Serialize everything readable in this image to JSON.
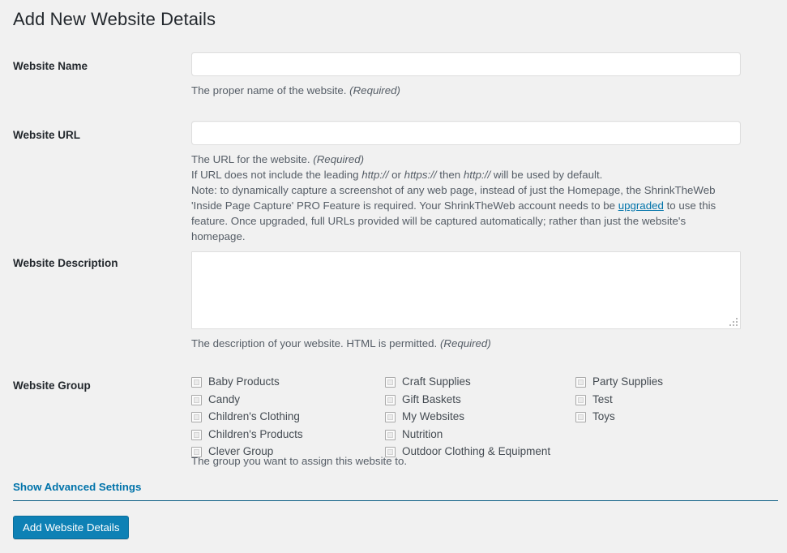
{
  "page": {
    "title": "Add New Website Details",
    "background_color": "#f1f1f1",
    "accent_color": "#0073aa"
  },
  "fields": {
    "website_name": {
      "label": "Website Name",
      "value": "",
      "placeholder": "",
      "help": "The proper name of the website. ",
      "help_required": "(Required)"
    },
    "website_url": {
      "label": "Website URL",
      "value": "",
      "placeholder": "",
      "help_line1": "The URL for the website. ",
      "help_line1_required": "(Required)",
      "help_line2_a": "If URL does not include the leading ",
      "help_line2_proto1": "http://",
      "help_line2_b": " or ",
      "help_line2_proto2": "https://",
      "help_line2_c": " then ",
      "help_line2_proto3": "http://",
      "help_line2_d": " will be used by default.",
      "help_line3_a": "Note: to dynamically capture a screenshot of any web page, instead of just the Homepage, the ShrinkTheWeb 'Inside Page Capture' PRO Feature is required. Your ShrinkTheWeb account needs to be ",
      "help_link": "upgraded",
      "help_line3_b": " to use this feature. Once upgraded, full URLs provided will be captured automatically; rather than just the website's homepage."
    },
    "website_description": {
      "label": "Website Description",
      "value": "",
      "placeholder": "",
      "help": "The description of your website. HTML is permitted. ",
      "help_required": "(Required)"
    },
    "website_group": {
      "label": "Website Group",
      "help": "The group you want to assign this website to.",
      "columns": [
        [
          {
            "label": "Baby Products",
            "checked": false
          },
          {
            "label": "Candy",
            "checked": false
          },
          {
            "label": "Children's Clothing",
            "checked": false
          },
          {
            "label": "Children's Products",
            "checked": false
          },
          {
            "label": "Clever Group",
            "checked": false
          }
        ],
        [
          {
            "label": "Craft Supplies",
            "checked": false
          },
          {
            "label": "Gift Baskets",
            "checked": false
          },
          {
            "label": "My Websites",
            "checked": false
          },
          {
            "label": "Nutrition",
            "checked": false
          },
          {
            "label": "Outdoor Clothing & Equipment",
            "checked": false
          }
        ],
        [
          {
            "label": "Party Supplies",
            "checked": false
          },
          {
            "label": "Test",
            "checked": false
          },
          {
            "label": "Toys",
            "checked": false
          }
        ]
      ]
    }
  },
  "advanced": {
    "toggle_label": "Show Advanced Settings"
  },
  "actions": {
    "submit_label": "Add Website Details"
  }
}
